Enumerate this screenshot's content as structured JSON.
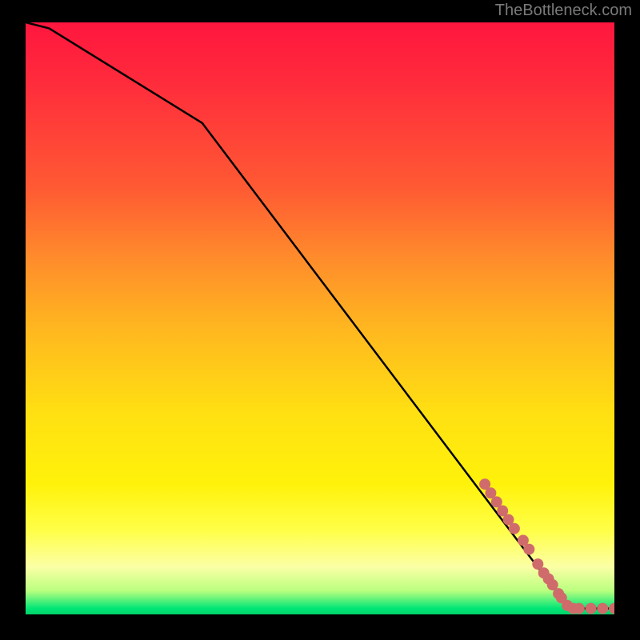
{
  "watermark": "TheBottleneck.com",
  "chart_data": {
    "type": "line",
    "title": "",
    "xlabel": "",
    "ylabel": "",
    "xlim": [
      0,
      100
    ],
    "ylim": [
      0,
      100
    ],
    "line": {
      "x": [
        0,
        4,
        30,
        90,
        92,
        100
      ],
      "y": [
        100,
        99,
        83,
        4,
        1,
        1
      ]
    },
    "scatter": {
      "name": "data-points",
      "color": "#d06b6b",
      "points": [
        {
          "x": 78,
          "y": 22
        },
        {
          "x": 79,
          "y": 20.5
        },
        {
          "x": 80,
          "y": 19
        },
        {
          "x": 81,
          "y": 17.5
        },
        {
          "x": 82,
          "y": 16
        },
        {
          "x": 83,
          "y": 14.5
        },
        {
          "x": 84.5,
          "y": 12.5
        },
        {
          "x": 85.5,
          "y": 11
        },
        {
          "x": 87,
          "y": 8.5
        },
        {
          "x": 88,
          "y": 7
        },
        {
          "x": 88.8,
          "y": 6
        },
        {
          "x": 89.5,
          "y": 5
        },
        {
          "x": 90.5,
          "y": 3.5
        },
        {
          "x": 91,
          "y": 2.8
        },
        {
          "x": 92,
          "y": 1.5
        },
        {
          "x": 93,
          "y": 1
        },
        {
          "x": 94,
          "y": 1
        },
        {
          "x": 96,
          "y": 1
        },
        {
          "x": 98,
          "y": 1
        },
        {
          "x": 100,
          "y": 1
        }
      ]
    }
  }
}
